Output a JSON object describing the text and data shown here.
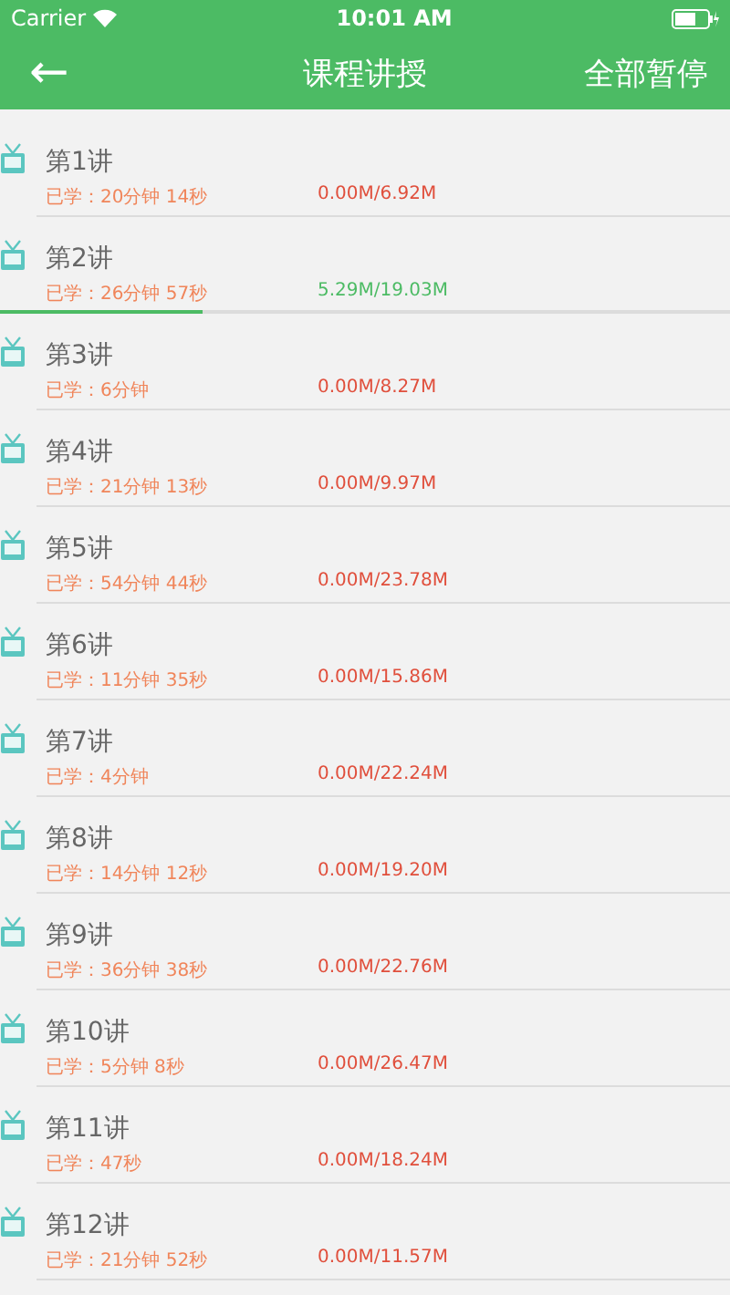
{
  "status_bar": {
    "carrier": "Carrier",
    "time": "10:01 AM"
  },
  "nav": {
    "back": "←",
    "title": "课程讲授",
    "action": "全部暂停"
  },
  "lectures": [
    {
      "title": "第1讲",
      "studied": "已学：20分钟 14秒",
      "size": "0.00M/6.92M",
      "downloading": false
    },
    {
      "title": "第2讲",
      "studied": "已学：26分钟 57秒",
      "size": "5.29M/19.03M",
      "downloading": true,
      "level": 0.278
    },
    {
      "title": "第3讲",
      "studied": "已学：6分钟",
      "size": "0.00M/8.27M",
      "downloading": false
    },
    {
      "title": "第4讲",
      "studied": "已学：21分钟 13秒",
      "size": "0.00M/9.97M",
      "downloading": false
    },
    {
      "title": "第5讲",
      "studied": "已学：54分钟 44秒",
      "size": "0.00M/23.78M",
      "downloading": false
    },
    {
      "title": "第6讲",
      "studied": "已学：11分钟 35秒",
      "size": "0.00M/15.86M",
      "downloading": false
    },
    {
      "title": "第7讲",
      "studied": "已学：4分钟",
      "size": "0.00M/22.24M",
      "downloading": false
    },
    {
      "title": "第8讲",
      "studied": "已学：14分钟 12秒",
      "size": "0.00M/19.20M",
      "downloading": false
    },
    {
      "title": "第9讲",
      "studied": "已学：36分钟 38秒",
      "size": "0.00M/22.76M",
      "downloading": false
    },
    {
      "title": "第10讲",
      "studied": "已学：5分钟 8秒",
      "size": "0.00M/26.47M",
      "downloading": false
    },
    {
      "title": "第11讲",
      "studied": "已学：47秒",
      "size": "0.00M/18.24M",
      "downloading": false
    },
    {
      "title": "第12讲",
      "studied": "已学：21分钟 52秒",
      "size": "0.00M/11.57M",
      "downloading": false
    }
  ]
}
